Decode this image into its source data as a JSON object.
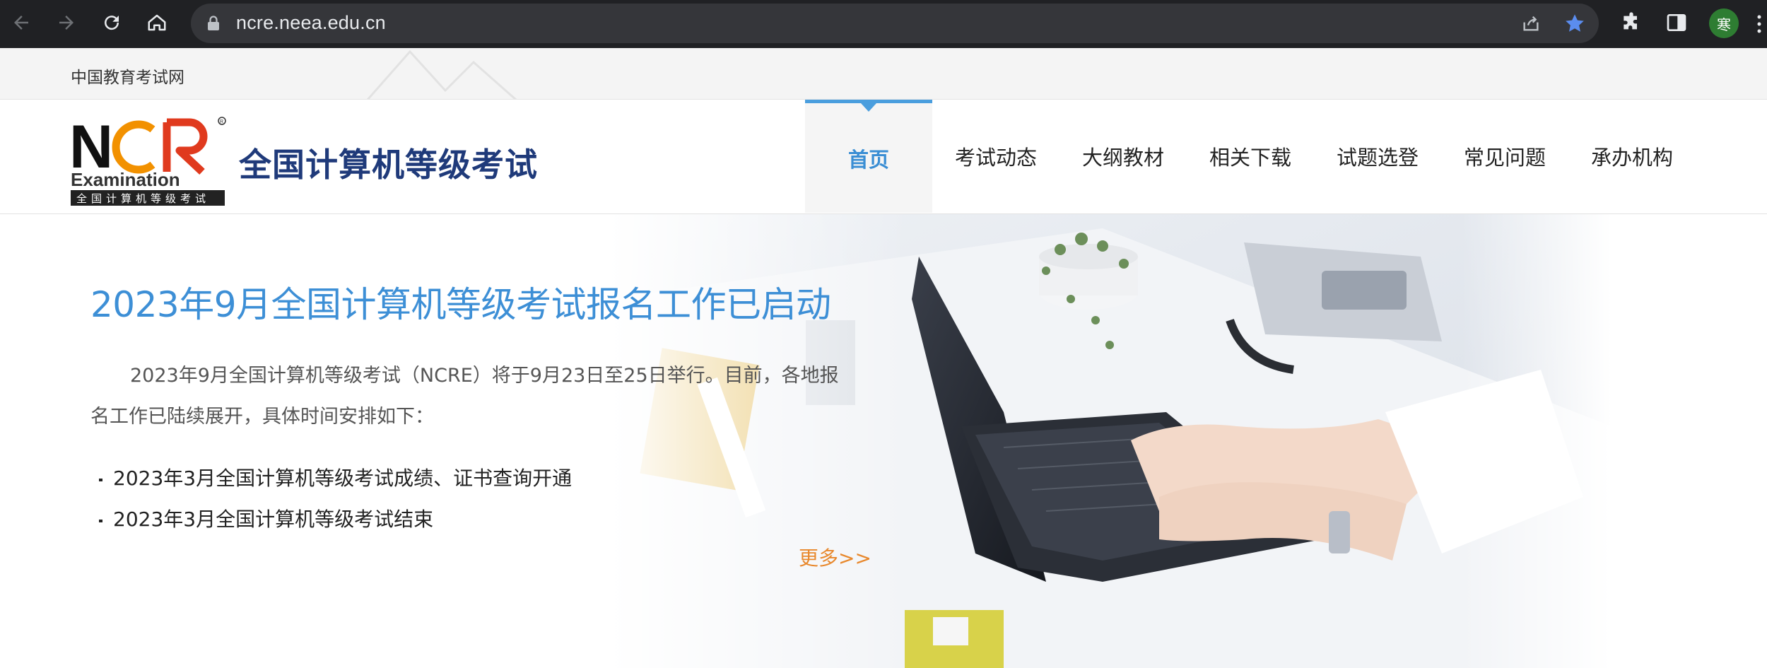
{
  "browser": {
    "url": "ncre.neea.edu.cn",
    "profile_initial": "寒",
    "icons": [
      "back-icon",
      "forward-icon",
      "reload-icon",
      "home-icon",
      "lock-icon",
      "share-icon",
      "star-icon",
      "extensions-icon",
      "sidepanel-icon",
      "more-icon"
    ],
    "star_color": "#5b8def"
  },
  "topbar": {
    "label": "中国教育考试网"
  },
  "header": {
    "logo_letters": "NCR",
    "logo_word": "Examination",
    "logo_tagline": "全国计算机等级考试",
    "site_title": "全国计算机等级考试",
    "nav": [
      {
        "label": "首页",
        "active": true
      },
      {
        "label": "考试动态",
        "active": false
      },
      {
        "label": "大纲教材",
        "active": false
      },
      {
        "label": "相关下载",
        "active": false
      },
      {
        "label": "试题选登",
        "active": false
      },
      {
        "label": "常见问题",
        "active": false
      },
      {
        "label": "承办机构",
        "active": false
      }
    ],
    "accent_color": "#4a9ede"
  },
  "banner": {
    "headline": "2023年9月全国计算机等级考试报名工作已启动",
    "intro": "2023年9月全国计算机等级考试（NCRE）将于9月23日至25日举行。目前，各地报名工作已陆续展开，具体时间安排如下：",
    "news": [
      "2023年3月全国计算机等级考试成绩、证书查询开通",
      "2023年3月全国计算机等级考试结束"
    ],
    "more_label": "更多>>",
    "more_color": "#e8882c"
  }
}
